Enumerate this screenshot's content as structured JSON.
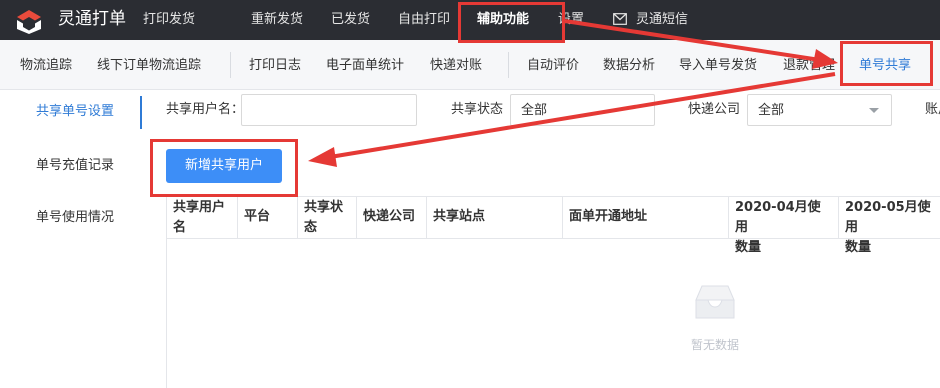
{
  "brand": {
    "name": "灵通打单"
  },
  "topnav": {
    "items": [
      {
        "label": "打印发货"
      },
      {
        "label": "重新发货"
      },
      {
        "label": "已发货"
      },
      {
        "label": "自由打印"
      },
      {
        "label": "辅助功能",
        "active": true
      },
      {
        "label": "设置"
      },
      {
        "label": "灵通短信",
        "icon": "mail-icon"
      }
    ]
  },
  "subnav": {
    "items": [
      {
        "label": "物流追踪"
      },
      {
        "label": "线下订单物流追踪"
      },
      {
        "label": "打印日志"
      },
      {
        "label": "电子面单统计"
      },
      {
        "label": "快递对账"
      },
      {
        "label": "自动评价"
      },
      {
        "label": "数据分析"
      },
      {
        "label": "导入单号发货"
      },
      {
        "label": "退款管理"
      },
      {
        "label": "单号共享",
        "active": true
      }
    ]
  },
  "sidebar": {
    "items": [
      {
        "label": "共享单号设置",
        "active": true
      },
      {
        "label": "单号充值记录"
      },
      {
        "label": "单号使用情况"
      }
    ]
  },
  "filters": {
    "user_label": "共享用户名：",
    "user_value": "",
    "status_label": "共享状态",
    "status_value": "全部",
    "express_label": "快递公司",
    "express_value": "全部",
    "account_label": "账户"
  },
  "actions": {
    "add_label": "新增共享用户"
  },
  "table": {
    "columns": [
      {
        "line1": "共享用户",
        "line2": "名"
      },
      {
        "line1": "平台",
        "line2": ""
      },
      {
        "line1": "共享状",
        "line2": "态"
      },
      {
        "line1": "快递公司",
        "line2": ""
      },
      {
        "line1": "共享站点",
        "line2": ""
      },
      {
        "line1": "面单开通地址",
        "line2": ""
      },
      {
        "line1": "2020-04月使用",
        "line2": "数量"
      },
      {
        "line1": "2020-05月使用",
        "line2": "数量"
      }
    ],
    "rows": [],
    "empty_text": "暂无数据"
  },
  "colors": {
    "topbar_bg": "#2b2d33",
    "accent": "#2f7bd6",
    "button_bg": "#3d8ef7",
    "annotation": "#e53935"
  }
}
